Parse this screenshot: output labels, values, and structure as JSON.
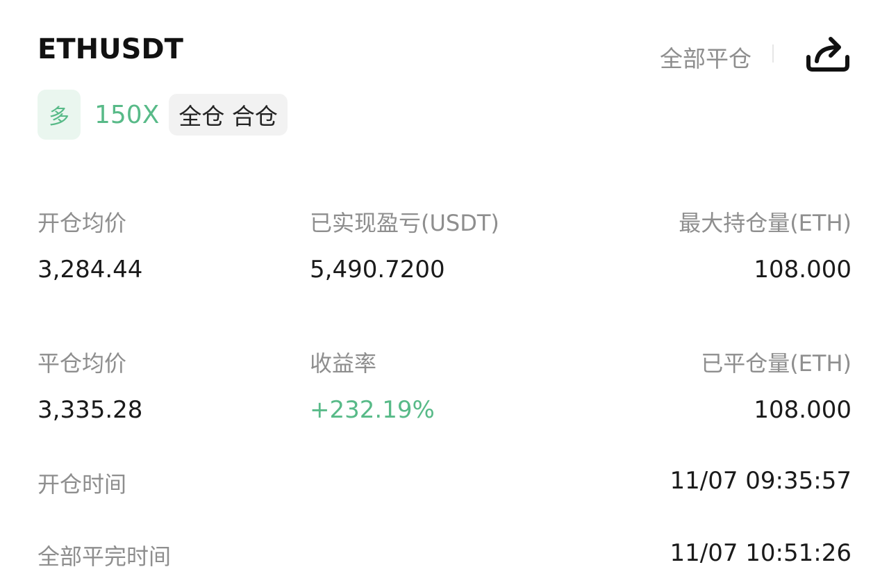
{
  "header": {
    "symbol": "ETHUSDT",
    "close_all_label": "全部平仓",
    "share_icon": "share-icon"
  },
  "tags": {
    "side": "多",
    "leverage": "150X",
    "margin_mode": "全仓 合仓"
  },
  "stats": {
    "open_avg_price": {
      "label": "开仓均价",
      "value": "3,284.44"
    },
    "realized_pnl": {
      "label": "已实现盈亏(USDT)",
      "value": "5,490.7200"
    },
    "max_position": {
      "label": "最大持仓量(ETH)",
      "value": "108.000"
    },
    "close_avg_price": {
      "label": "平仓均价",
      "value": "3,335.28"
    },
    "roi": {
      "label": "收益率",
      "value": "+232.19%"
    },
    "closed_volume": {
      "label": "已平仓量(ETH)",
      "value": "108.000"
    },
    "open_time": {
      "label": "开仓时间",
      "value": "11/07 09:35:57"
    },
    "full_close_time": {
      "label": "全部平完时间",
      "value": "11/07 10:51:26"
    }
  },
  "colors": {
    "positive": "#58ba88",
    "label": "#8e8e8e",
    "text": "#1a1a1a"
  }
}
